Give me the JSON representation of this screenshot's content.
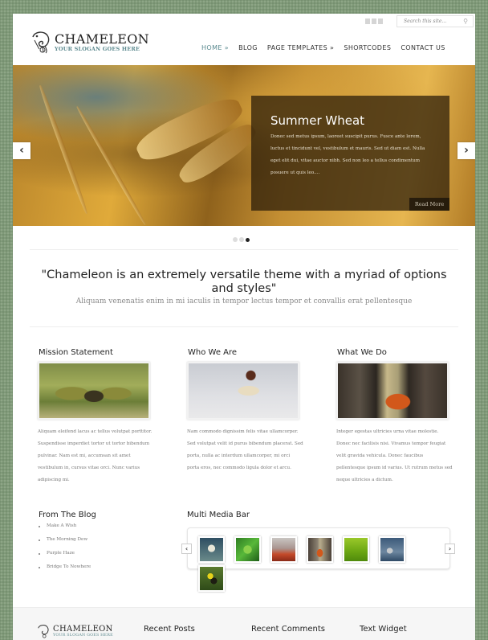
{
  "header": {
    "logo_title": "CHAMELEON",
    "logo_slogan": "YOUR SLOGAN GOES HERE",
    "social_icons": [
      "twitter-icon",
      "rss-icon",
      "facebook-icon"
    ],
    "search": {
      "placeholder": "Search this site...",
      "icon": "search-icon"
    },
    "nav": [
      {
        "label": "HOME »",
        "active": true
      },
      {
        "label": "BLOG",
        "active": false
      },
      {
        "label": "PAGE TEMPLATES »",
        "active": false
      },
      {
        "label": "SHORTCODES",
        "active": false
      },
      {
        "label": "CONTACT US",
        "active": false
      }
    ]
  },
  "slider": {
    "title": "Summer Wheat",
    "text": "Donec sed metus ipsum, laoreet suscipit purus. Fusce ante lorem, luctus et tincidunt vel, vestibulum et mauris. Sed ut diam est. Nulla eget elit dui, vitae auctor nibh. Sed non leo a tellus condimentum posuere ut quis leo....",
    "read_more": "Read More",
    "prev_icon": "‹",
    "next_icon": "›",
    "slides_total": 3,
    "active_slide": 3
  },
  "tagline": {
    "quote": "\"Chameleon is an extremely versatile theme with a myriad of options and styles\"",
    "sub": "Aliquam venenatis enim in mi iaculis in tempor lectus tempor et convallis erat pellentesque"
  },
  "columns": [
    {
      "title": "Mission Statement",
      "text": "Aliquam eleifend lacus ac tellus volutpat porttitor. Suspendisse imperdiet tortor ut tortor bibendum pulvinar. Nam est mi, accumsan sit amet vestibulum in, cursus vitae orci. Nunc varius adipiscing mi."
    },
    {
      "title": "Who We Are",
      "text": "Nam commodo dignissim felis vitae ullamcorper. Sed volutpat velit id purus bibendum placerat. Sed porta, nulla ac interdum ullamcorper, mi orci porta eros, nec commodo ligula dolor et arcu."
    },
    {
      "title": "What We Do",
      "text": "Integer egestas ultricies urna vitae molestie. Donec nec facilisis nisi. Vivamus tempor feugiat velit gravida vehicula. Donec faucibus pellentesque ipsum id varius. Ut rutrum metus sed neque ultricies a dictum."
    }
  ],
  "blog": {
    "title": "From The Blog",
    "items": [
      "Make A Wish",
      "The Morning Dew",
      "Purple Haze",
      "Bridge To Nowhere"
    ]
  },
  "media_bar": {
    "title": "Multi Media Bar",
    "prev_icon": "‹",
    "next_icon": "›",
    "thumb_colors": [
      "#4d6f7e",
      "#3f9a2d",
      "#b33a24",
      "#c86020",
      "#7ab51e",
      "#4c6a8a",
      "#3d5a2a"
    ]
  },
  "footer": {
    "logo_title": "CHAMELEON",
    "logo_slogan": "YOUR SLOGAN GOES HERE",
    "headings": [
      "Recent Posts",
      "Recent Comments",
      "Text Widget"
    ]
  }
}
